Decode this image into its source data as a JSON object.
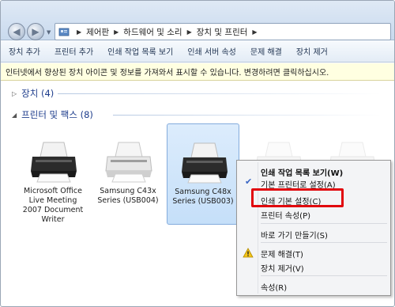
{
  "address": {
    "crumbs": [
      "제어판",
      "하드웨어 및 소리",
      "장치 및 프린터"
    ]
  },
  "toolbar": {
    "items": [
      "장치 추가",
      "프린터 추가",
      "인쇄 작업 목록 보기",
      "인쇄 서버 속성",
      "문제 해결",
      "장치 제거"
    ]
  },
  "infobar": {
    "text": "인터넷에서 향상된 장치 아이콘 및 정보를 가져와서 표시할 수 있습니다. 변경하려면 클릭하십시오."
  },
  "groups": {
    "devices": "장치 (4)",
    "printers": "프린터 및 팩스 (8)"
  },
  "printers": [
    {
      "label": "Microsoft Office Live Meeting 2007 Document Writer",
      "line1": "Microsoft Office",
      "line2": "Live Meeting",
      "line3": "2007 Document",
      "line4": "Writer"
    },
    {
      "label": "Samsung C43x Series (USB004)",
      "line1": "Samsung C43x",
      "line2": "Series (USB004)"
    },
    {
      "label": "Samsung C48x Series (USB003)",
      "line1": "Samsung C48x",
      "line2": "Series (USB003)"
    }
  ],
  "context_menu": {
    "items": [
      {
        "label": "인쇄 작업 목록 보기(W)",
        "bold": true
      },
      {
        "label": "기본 프린터로 설정(A)",
        "checked": true
      },
      {
        "label": "인쇄 기본 설정(C)",
        "highlighted": true
      },
      {
        "label": "프린터 속성(P)"
      },
      {
        "label": "바로 가기 만들기(S)"
      },
      {
        "label": "문제 해결(T)",
        "icon": "warning-icon"
      },
      {
        "label": "장치 제거(V)"
      },
      {
        "label": "속성(R)"
      }
    ]
  },
  "colors": {
    "highlight_box": "#e1070d",
    "group_header": "#1e3d8c",
    "selection": "#c5dff9"
  }
}
